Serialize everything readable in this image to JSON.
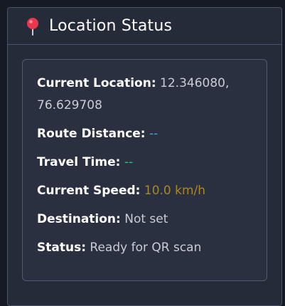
{
  "panel": {
    "title": "Location Status",
    "icon": "pushpin-icon"
  },
  "status": {
    "current_location": {
      "label": "Current Location:",
      "value": "12.346080, 76.629708"
    },
    "route_distance": {
      "label": "Route Distance:",
      "value": "--",
      "color": "#3ba4e6"
    },
    "travel_time": {
      "label": "Travel Time:",
      "value": "--",
      "color": "#27c96b"
    },
    "current_speed": {
      "label": "Current Speed:",
      "value": "10.0 km/h",
      "color": "#a8872a"
    },
    "destination": {
      "label": "Destination:",
      "value": "Not set"
    },
    "status": {
      "label": "Status:",
      "value": "Ready for QR scan"
    }
  },
  "colors": {
    "background": "#161a24",
    "panel": "#262b3a",
    "card": "#2a3040",
    "border": "#4a5268"
  }
}
